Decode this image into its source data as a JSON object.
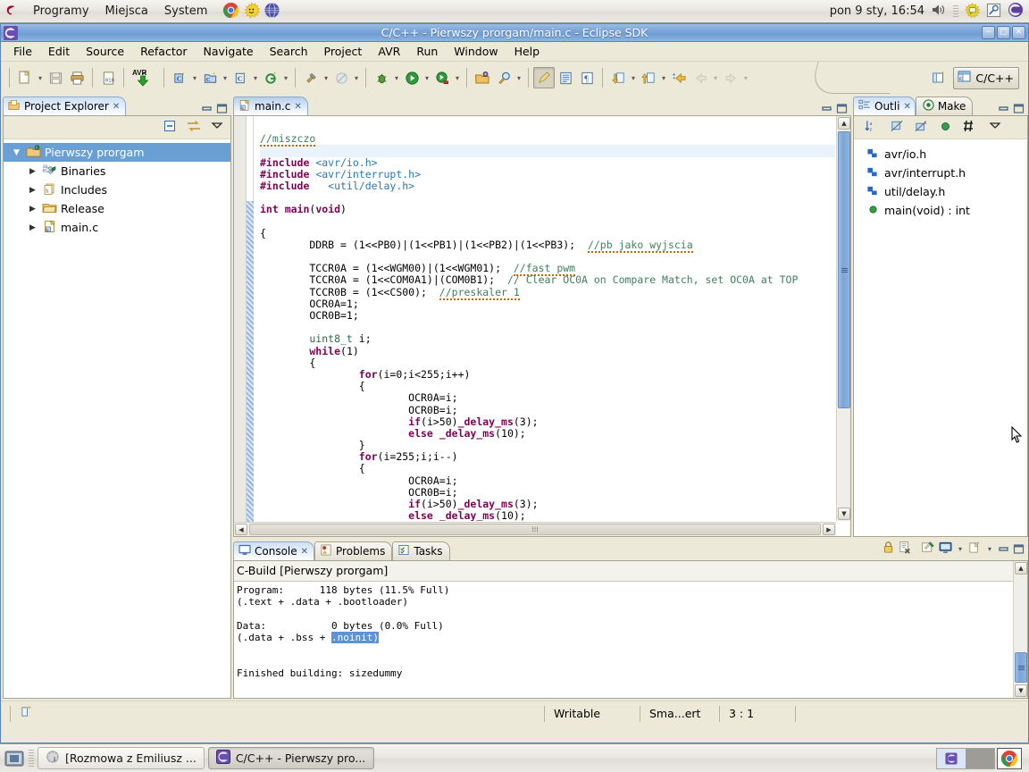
{
  "desktop": {
    "panel": {
      "logo_icon": "debian-swirl-icon",
      "menus": [
        "Programy",
        "Miejsca",
        "System"
      ],
      "launchers": [
        "chrome-icon",
        "sun-icon",
        "globe-icon"
      ],
      "clock": "pon  9 sty, 16:54",
      "tray": [
        "volume-icon",
        "update-icon",
        "search-icon",
        "eclipse-icon"
      ]
    },
    "taskbar": {
      "show_desktop_icon": "show-desktop-icon",
      "buttons": [
        {
          "icon": "pidgin-icon",
          "label": "[Rozmowa z Emiliusz ..."
        },
        {
          "icon": "eclipse-icon",
          "label": "C/C++ - Pierwszy pro..."
        }
      ],
      "workspaces": [
        "eclipse-icon",
        ""
      ],
      "tray_icon": "chrome-icon"
    }
  },
  "window": {
    "title": "C/C++ - Pierwszy prorgam/main.c - Eclipse SDK",
    "icon": "eclipse-icon",
    "controls": {
      "minimize": "−",
      "maximize": "□",
      "close": "✕"
    }
  },
  "menubar": {
    "items": [
      {
        "label": "File",
        "mnemonic": "F"
      },
      {
        "label": "Edit",
        "mnemonic": "E"
      },
      {
        "label": "Source",
        "mnemonic": "S"
      },
      {
        "label": "Refactor",
        "mnemonic": "t"
      },
      {
        "label": "Navigate",
        "mnemonic": "N"
      },
      {
        "label": "Search",
        "mnemonic": "a"
      },
      {
        "label": "Project",
        "mnemonic": "P"
      },
      {
        "label": "AVR",
        "mnemonic": "V"
      },
      {
        "label": "Run",
        "mnemonic": "R"
      },
      {
        "label": "Window",
        "mnemonic": "W"
      },
      {
        "label": "Help",
        "mnemonic": "H"
      }
    ]
  },
  "toolbar": {
    "groups": [
      [
        "new-wizard-icon",
        "save-icon",
        "print-icon"
      ],
      [
        "build-all-icon"
      ],
      [
        "avr-download-icon"
      ],
      [
        "new-c-class-icon",
        "new-c-project-icon",
        "new-c-file-icon",
        "new-g-icon"
      ],
      [
        "build-hammer-icon",
        "build-disabled-icon"
      ],
      [
        "debug-icon",
        "run-icon",
        "external-tools-icon"
      ],
      [
        "open-resource-icon",
        "search-icon"
      ],
      [
        "toggle-mark-occurrences-icon",
        "show-whitespace-icon",
        "show-pilcrow-icon"
      ],
      [
        "next-annotation-icon",
        "previous-annotation-icon",
        "last-edit-location-icon",
        "back-icon",
        "forward-icon"
      ]
    ],
    "perspective": {
      "open_perspective_icon": "open-perspective-icon",
      "active_icon": "cpp-perspective-icon",
      "active_label": "C/C++"
    }
  },
  "project_explorer": {
    "tab_label": "Project Explorer",
    "tab_icon": "project-explorer-icon",
    "close_icon": "close-icon",
    "minimize_icon": "minimize-icon",
    "maximize_icon": "maximize-icon",
    "toolbar": [
      "collapse-all-icon",
      "link-with-editor-icon",
      "view-menu-icon"
    ],
    "tree": [
      {
        "label": "Pierwszy prorgam",
        "icon": "c-project-icon",
        "expanded": true,
        "selected": true,
        "indent": 0
      },
      {
        "label": "Binaries",
        "icon": "binaries-icon",
        "expanded": false,
        "selected": false,
        "indent": 1
      },
      {
        "label": "Includes",
        "icon": "includes-icon",
        "expanded": false,
        "selected": false,
        "indent": 1
      },
      {
        "label": "Release",
        "icon": "folder-icon",
        "expanded": false,
        "selected": false,
        "indent": 1
      },
      {
        "label": "main.c",
        "icon": "c-file-icon",
        "expanded": false,
        "selected": false,
        "indent": 1
      }
    ]
  },
  "editor": {
    "tab_label": "main.c",
    "tab_icon": "c-file-icon",
    "close_icon": "close-icon",
    "minimize_icon": "minimize-icon",
    "maximize_icon": "maximize-icon",
    "scroll_hint": "⁞⁞⁞",
    "code_lines": [
      {
        "segments": []
      },
      {
        "segments": [
          {
            "t": "//miszczo",
            "c": "cm spell"
          }
        ]
      },
      {
        "segments": [],
        "highlight": true
      },
      {
        "segments": [
          {
            "t": "#include ",
            "c": "pp"
          },
          {
            "t": "<avr/io.h>",
            "c": "inc"
          }
        ]
      },
      {
        "segments": [
          {
            "t": "#include ",
            "c": "pp"
          },
          {
            "t": "<avr/interrupt.h>",
            "c": "inc"
          }
        ]
      },
      {
        "segments": [
          {
            "t": "#include ",
            "c": "pp"
          },
          {
            "t": "  <util/delay.h>",
            "c": "inc"
          }
        ]
      },
      {
        "segments": []
      },
      {
        "segments": [
          {
            "t": "int ",
            "c": "kw"
          },
          {
            "t": "main",
            "c": "kw"
          },
          {
            "t": "(",
            "c": ""
          },
          {
            "t": "void",
            "c": "kw"
          },
          {
            "t": ")",
            "c": ""
          }
        ]
      },
      {
        "segments": []
      },
      {
        "segments": [
          {
            "t": "{",
            "c": ""
          }
        ]
      },
      {
        "segments": [
          {
            "t": "        DDRB = (1<<PB0)|(1<<PB1)|(1<<PB2)|(1<<PB3);  ",
            "c": ""
          },
          {
            "t": "//pb jako wyjscia",
            "c": "cm spell"
          }
        ]
      },
      {
        "segments": []
      },
      {
        "segments": [
          {
            "t": "        TCCR0A = (1<<WGM00)|(1<<WGM01);  ",
            "c": ""
          },
          {
            "t": "//fast pwm",
            "c": "cm spell"
          }
        ]
      },
      {
        "segments": [
          {
            "t": "        TCCR0A = (1<<COM0A1)|(COM0B1);  ",
            "c": ""
          },
          {
            "t": "// Clear OC0A on Compare Match, set OC0A at TOP",
            "c": "cm"
          }
        ]
      },
      {
        "segments": [
          {
            "t": "        TCCR0B = (1<<CS00);  ",
            "c": ""
          },
          {
            "t": "//preskaler 1",
            "c": "cm spell"
          }
        ]
      },
      {
        "segments": [
          {
            "t": "        OCR0A=1;",
            "c": ""
          }
        ]
      },
      {
        "segments": [
          {
            "t": "        OCR0B=1;",
            "c": ""
          }
        ]
      },
      {
        "segments": []
      },
      {
        "segments": [
          {
            "t": "        uint8_t",
            "c": "typ"
          },
          {
            "t": " i;",
            "c": ""
          }
        ]
      },
      {
        "segments": [
          {
            "t": "        while",
            "c": "kw"
          },
          {
            "t": "(1)",
            "c": ""
          }
        ]
      },
      {
        "segments": [
          {
            "t": "        {",
            "c": ""
          }
        ]
      },
      {
        "segments": [
          {
            "t": "                for",
            "c": "kw"
          },
          {
            "t": "(i=0;i<255;i++)",
            "c": ""
          }
        ]
      },
      {
        "segments": [
          {
            "t": "                {",
            "c": ""
          }
        ]
      },
      {
        "segments": [
          {
            "t": "                        OCR0A=i;",
            "c": ""
          }
        ]
      },
      {
        "segments": [
          {
            "t": "                        OCR0B=i;",
            "c": ""
          }
        ]
      },
      {
        "segments": [
          {
            "t": "                        if",
            "c": "kw"
          },
          {
            "t": "(i>50)",
            "c": ""
          },
          {
            "t": "_delay_ms",
            "c": "kw"
          },
          {
            "t": "(3);",
            "c": ""
          }
        ]
      },
      {
        "segments": [
          {
            "t": "                        else ",
            "c": "kw"
          },
          {
            "t": "_delay_ms",
            "c": "kw"
          },
          {
            "t": "(10);",
            "c": ""
          }
        ]
      },
      {
        "segments": [
          {
            "t": "                }",
            "c": ""
          }
        ]
      },
      {
        "segments": [
          {
            "t": "                for",
            "c": "kw"
          },
          {
            "t": "(i=255;i;i--)",
            "c": ""
          }
        ]
      },
      {
        "segments": [
          {
            "t": "                {",
            "c": ""
          }
        ]
      },
      {
        "segments": [
          {
            "t": "                        OCR0A=i;",
            "c": ""
          }
        ]
      },
      {
        "segments": [
          {
            "t": "                        OCR0B=i;",
            "c": ""
          }
        ]
      },
      {
        "segments": [
          {
            "t": "                        if",
            "c": "kw"
          },
          {
            "t": "(i>50)",
            "c": ""
          },
          {
            "t": "_delay_ms",
            "c": "kw"
          },
          {
            "t": "(3);",
            "c": ""
          }
        ]
      },
      {
        "segments": [
          {
            "t": "                        else ",
            "c": "kw"
          },
          {
            "t": "_delay_ms",
            "c": "kw"
          },
          {
            "t": "(10);",
            "c": ""
          }
        ]
      }
    ]
  },
  "outline": {
    "tabs": [
      {
        "label": "Outli",
        "icon": "outline-icon",
        "active": true,
        "close_icon": "close-icon"
      },
      {
        "label": "Make",
        "icon": "make-target-icon",
        "active": false
      }
    ],
    "minimize_icon": "minimize-icon",
    "maximize_icon": "maximize-icon",
    "toolbar": [
      "sort-az-icon",
      "hide-fields-icon",
      "hide-static-icon",
      "hide-nonpublic-icon",
      "hide-macros-icon",
      "view-menu-icon"
    ],
    "items": [
      {
        "label": "avr/io.h",
        "icon": "include-icon"
      },
      {
        "label": "avr/interrupt.h",
        "icon": "include-icon"
      },
      {
        "label": "util/delay.h",
        "icon": "include-icon"
      },
      {
        "label": "main(void) : int",
        "icon": "function-icon"
      }
    ]
  },
  "console": {
    "tabs": [
      {
        "label": "Console",
        "icon": "console-icon",
        "active": true,
        "close_icon": "close-icon"
      },
      {
        "label": "Problems",
        "icon": "problems-icon",
        "active": false
      },
      {
        "label": "Tasks",
        "icon": "tasks-icon",
        "active": false
      }
    ],
    "toolbar": [
      "lock-console-icon",
      "clear-console-icon",
      "pin-console-icon",
      "display-console-icon",
      "open-console-icon"
    ],
    "minimize_icon": "minimize-icon",
    "maximize_icon": "maximize-icon",
    "header": "C-Build [Pierwszy prorgam]",
    "output": [
      "Program:      118 bytes (11.5% Full)",
      "(.text + .data + .bootloader)",
      "",
      "Data:           0 bytes (0.0% Full)",
      "(.data + .bss + "
    ],
    "selected_token": ".noinit)",
    "output_tail": [
      "",
      "",
      "Finished building: sizedummy"
    ]
  },
  "statusbar": {
    "left_icon": "smart-insert-icon",
    "writable": "Writable",
    "insert_mode": "Sma...ert",
    "position": "3 : 1"
  },
  "colors": {
    "accent": "#6a9fd4",
    "titlebar": "#7ea7da",
    "chrome": "#ece9d8",
    "comment": "#3f7f5f",
    "keyword": "#7f0055",
    "include": "#2a7ab0",
    "selection": "#5c93d6"
  }
}
